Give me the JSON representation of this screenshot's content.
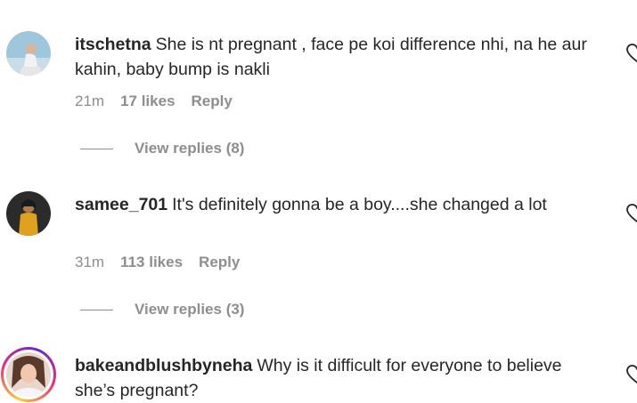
{
  "comments": [
    {
      "username": "itschetna",
      "text": "She is nt pregnant , face pe koi difference nhi, na he aur kahin, baby bump is nakli",
      "time": "21m",
      "likes": "17 likes",
      "reply_label": "Reply",
      "view_replies": "View replies (8)",
      "avatar_icon": "user-avatar-photo",
      "like_icon": "heart-outline-icon"
    },
    {
      "username": "samee_701",
      "text": "It's definitely gonna be a boy....she changed a lot",
      "time": "31m",
      "likes": "113 likes",
      "reply_label": "Reply",
      "view_replies": "View replies (3)",
      "avatar_icon": "user-avatar-photo",
      "like_icon": "heart-outline-icon"
    },
    {
      "username": "bakeandblushbyneha",
      "text": "Why is it difficult for everyone to believe she’s pregnant?",
      "avatar_icon": "user-avatar-photo",
      "like_icon": "heart-outline-icon",
      "has_story_ring": true
    }
  ],
  "colors": {
    "text": "#262626",
    "secondary": "#8e8e8e",
    "story_ring": [
      "#f9ce34",
      "#ee2a7b",
      "#6228d7"
    ]
  }
}
